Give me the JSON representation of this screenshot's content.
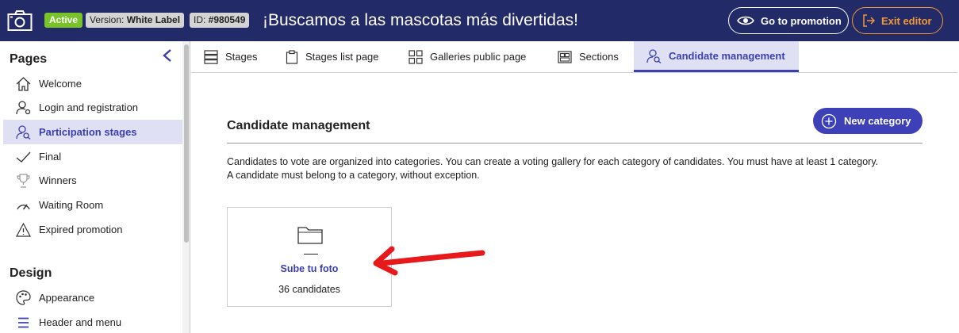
{
  "header": {
    "status_badge": "Active",
    "version_prefix": "Version: ",
    "version_value": "White Label",
    "id_prefix": "ID: ",
    "id_value": "#980549",
    "promotion_title": "¡Buscamos a las mascotas más divertidas!",
    "go_to_promotion": "Go to promotion",
    "exit_editor": "Exit editor",
    "colors": {
      "bar": "#232a68",
      "active_badge": "#79c32a",
      "exit_accent": "#f09a3a"
    }
  },
  "sidebar": {
    "pages_heading": "Pages",
    "pages_items": [
      {
        "label": "Welcome",
        "icon": "home-icon"
      },
      {
        "label": "Login and registration",
        "icon": "user-gear-icon"
      },
      {
        "label": "Participation stages",
        "icon": "user-search-icon",
        "active": true
      },
      {
        "label": "Final",
        "icon": "checkmark-icon"
      },
      {
        "label": "Winners",
        "icon": "trophy-icon"
      },
      {
        "label": "Waiting Room",
        "icon": "speedometer-icon"
      },
      {
        "label": "Expired promotion",
        "icon": "warning-icon"
      }
    ],
    "design_heading": "Design",
    "design_items": [
      {
        "label": "Appearance",
        "icon": "palette-icon"
      },
      {
        "label": "Header and menu",
        "icon": "menu-icon"
      }
    ],
    "accent": "#3c3fb0"
  },
  "tabs": [
    {
      "label": "Stages",
      "icon": "stages-icon"
    },
    {
      "label": "Stages list page",
      "icon": "clipboard-icon"
    },
    {
      "label": "Galleries public page",
      "icon": "grid-icon"
    },
    {
      "label": "Sections",
      "icon": "sections-icon"
    },
    {
      "label": "Candidate management",
      "icon": "user-search-icon",
      "active": true
    }
  ],
  "main": {
    "title": "Candidate management",
    "new_category_button": "New category",
    "description_line1": "Candidates to vote are organized into categories. You can create a voting gallery for each category of candidates. You must have at least 1 category.",
    "description_line2": "A candidate must belong to a category, without exception.",
    "categories": [
      {
        "name": "Sube tu foto",
        "count_label": "36 candidates",
        "icon": "folder-icon"
      }
    ],
    "annotation_arrow_color": "#e8191b"
  }
}
